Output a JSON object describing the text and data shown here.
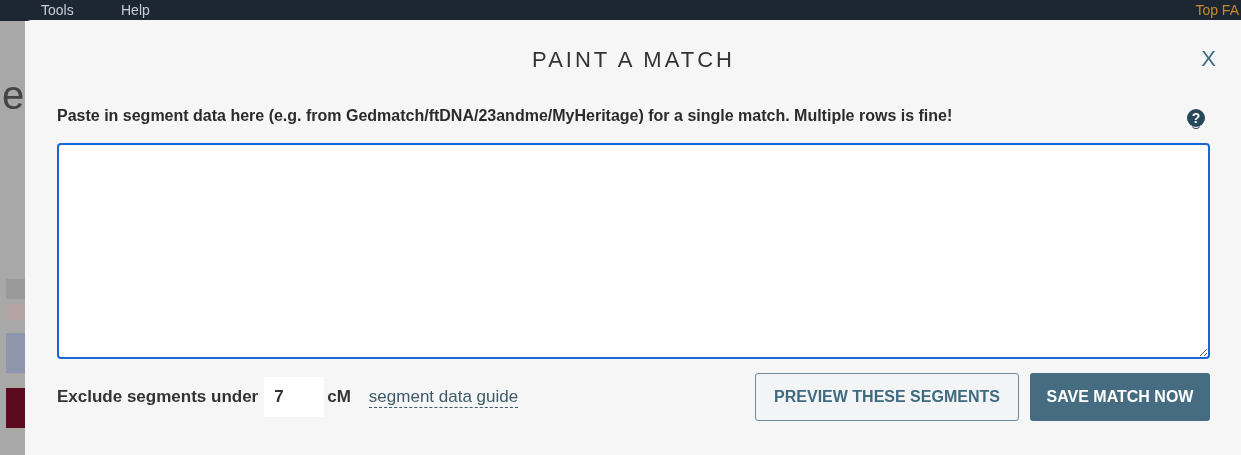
{
  "navbar": {
    "menu": [
      "Tools",
      "Help"
    ],
    "right_link": "Top FA"
  },
  "background_page": {
    "heading_fragment": "e"
  },
  "dialog": {
    "title": "PAINT A MATCH",
    "close": "X",
    "instructions": "Paste in segment data here (e.g. from Gedmatch/ftDNA/23andme/MyHeritage) for a single match. Multiple rows is fine!",
    "help": "?",
    "segment_data": {
      "focused": true
    },
    "threshold": {
      "label": "Exclude segments under",
      "value": "7",
      "unit": "cM"
    },
    "guide_link": "segment data guide",
    "buttons": [
      {
        "label": "PREVIEW THESE SEGMENTS",
        "kind": "outline"
      },
      {
        "label": "SAVE MATCH NOW",
        "kind": "primary"
      }
    ]
  }
}
